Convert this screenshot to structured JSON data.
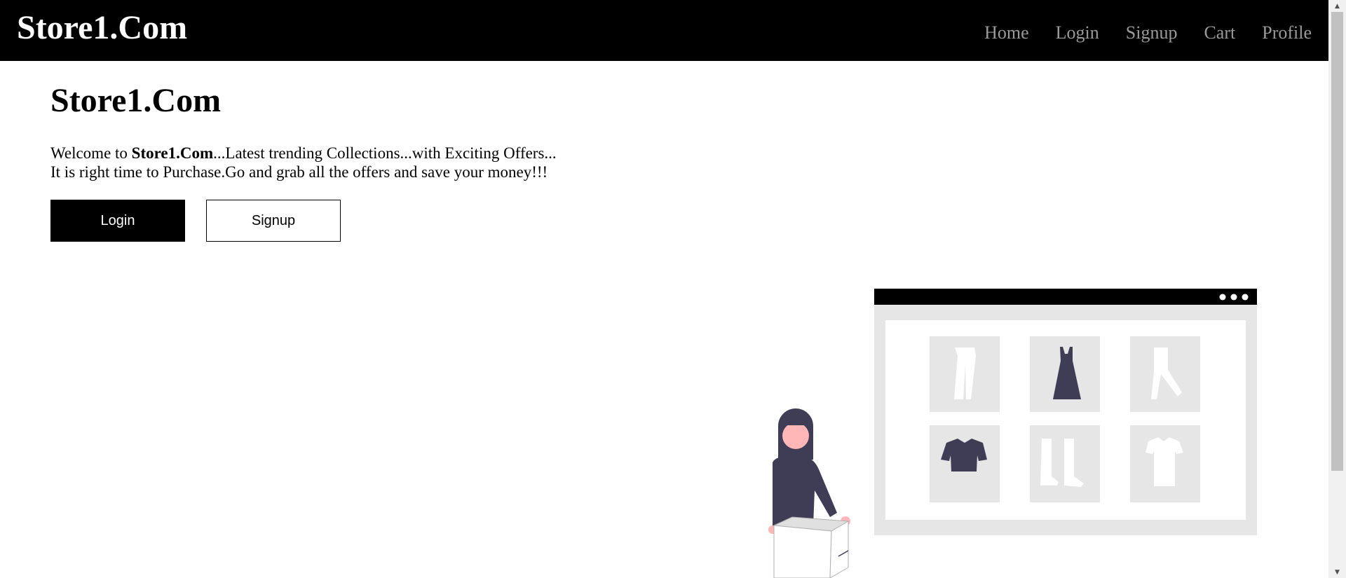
{
  "navbar": {
    "brand": "Store1.Com",
    "links": [
      "Home",
      "Login",
      "Signup",
      "Cart",
      "Profile"
    ]
  },
  "hero": {
    "title": "Store1.Com",
    "line1_prefix": "Welcome to ",
    "line1_brand": "Store1.Com",
    "line1_suffix": "...Latest trending Collections...with Exciting Offers...",
    "line2": "It is right time to Purchase.Go and grab all the offers and save your money!!!",
    "login_button": "Login",
    "signup_button": "Signup"
  },
  "illustration": {
    "items": [
      "pants-icon",
      "dress-icon",
      "trousers-icon",
      "sweater-icon",
      "boots-icon",
      "tshirt-icon"
    ]
  },
  "colors": {
    "navbar": "#000000",
    "nav_link": "#9a9a9a",
    "garment_dark": "#3f3d56",
    "skin": "#ffb6b6",
    "panel": "#e6e6e6"
  }
}
